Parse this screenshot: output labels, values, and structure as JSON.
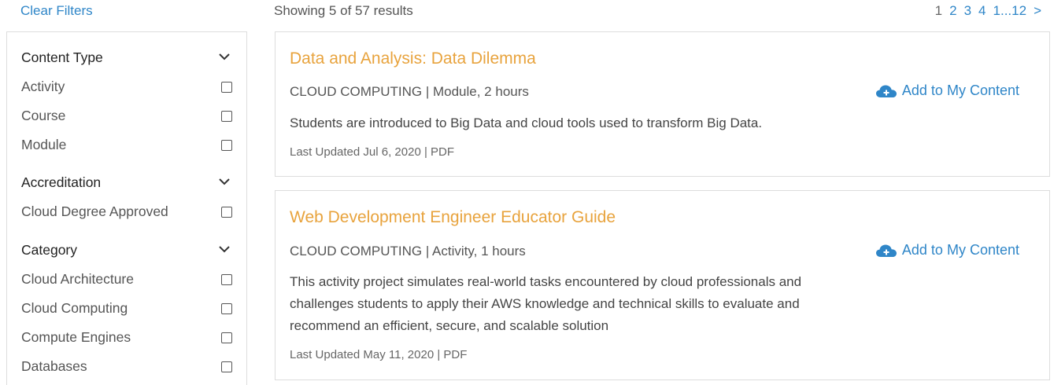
{
  "filters": {
    "clear_label": "Clear Filters",
    "groups": [
      {
        "title": "Content Type",
        "items": [
          "Activity",
          "Course",
          "Module"
        ]
      },
      {
        "title": "Accreditation",
        "items": [
          "Cloud Degree Approved"
        ]
      },
      {
        "title": "Category",
        "items": [
          "Cloud Architecture",
          "Cloud Computing",
          "Compute Engines",
          "Databases"
        ]
      }
    ]
  },
  "results": {
    "count_text": "Showing 5 of 57 results",
    "pagination": {
      "current": "1",
      "pages": [
        "2",
        "3",
        "4"
      ],
      "range": "1...12",
      "next": ">"
    }
  },
  "cards": [
    {
      "title": "Data and Analysis: Data Dilemma",
      "meta": "CLOUD COMPUTING | Module, 2 hours",
      "description": "Students are introduced to Big Data and cloud tools used to transform Big Data.",
      "updated": "Last Updated Jul 6, 2020 | PDF",
      "action_label": "Add to My Content"
    },
    {
      "title": "Web Development Engineer Educator Guide",
      "meta": "CLOUD COMPUTING | Activity, 1 hours",
      "description": "This activity project simulates real-world tasks encountered by cloud professionals and challenges students to apply their AWS knowledge and technical skills to evaluate and recommend an efficient, secure, and scalable solution",
      "updated": "Last Updated May 11, 2020 | PDF",
      "action_label": "Add to My Content"
    }
  ],
  "colors": {
    "link": "#2f86c8",
    "title": "#e8a33d",
    "border": "#dddddd"
  },
  "icons": {
    "group_toggle": "chevron-down-icon",
    "add_action": "cloud-plus-icon"
  }
}
